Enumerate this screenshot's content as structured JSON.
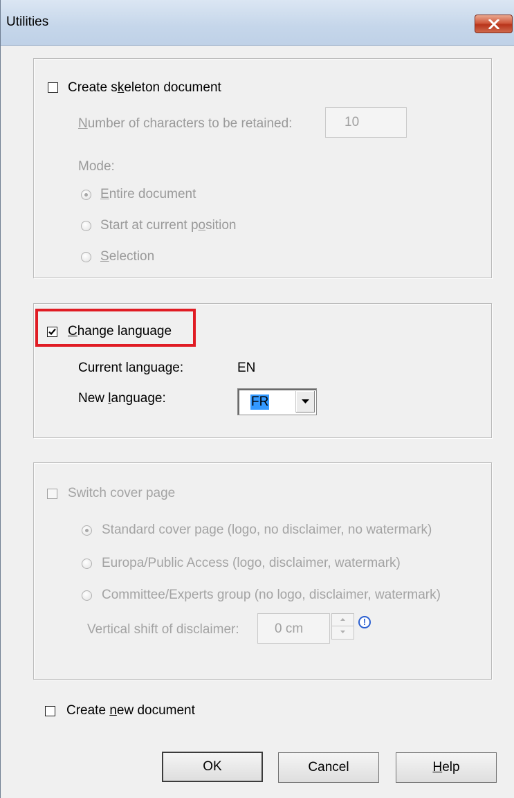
{
  "window": {
    "title": "Utilities",
    "close_icon": "close-icon",
    "accent": "#c7513a"
  },
  "skeleton": {
    "checkbox_label_before": "Create s",
    "checkbox_label_mnemonic": "k",
    "checkbox_label_after": "eleton document",
    "checked": false,
    "chars_label_mnemonic": "N",
    "chars_label_rest": "umber of characters to be retained:",
    "chars_value": "10",
    "mode_label": "Mode:",
    "mode_entire_mnemonic": "E",
    "mode_entire_rest": "ntire document",
    "mode_start_before": "Start at current p",
    "mode_start_mnemonic": "o",
    "mode_start_after": "sition",
    "mode_selection_mnemonic": "S",
    "mode_selection_rest": "election",
    "selected_mode": "Entire document"
  },
  "language": {
    "checkbox_label_mnemonic": "C",
    "checkbox_label_rest": "hange language",
    "checked": true,
    "current_label": "Current language:",
    "current_value": "EN",
    "new_label_before": "New ",
    "new_label_mnemonic": "l",
    "new_label_after": "anguage:",
    "new_value": "FR",
    "highlight_color": "#e01c24"
  },
  "cover": {
    "checkbox_label": "Switch cover page",
    "checked": false,
    "option_standard": "Standard cover page (logo, no disclaimer, no watermark)",
    "option_europa": "Europa/Public Access (logo, disclaimer, watermark)",
    "option_committee": "Committee/Experts group (no logo, disclaimer, watermark)",
    "selected_option": "Standard cover page (logo, no disclaimer, no watermark)",
    "shift_label": "Vertical shift of disclaimer:",
    "shift_value": "0 cm",
    "info_icon": "info-icon",
    "info_glyph": "!"
  },
  "new_document": {
    "label_before": "Create ",
    "label_mnemonic": "n",
    "label_after": "ew document",
    "checked": false
  },
  "buttons": {
    "ok": "OK",
    "cancel": "Cancel",
    "help_mnemonic": "H",
    "help_rest": "elp"
  }
}
